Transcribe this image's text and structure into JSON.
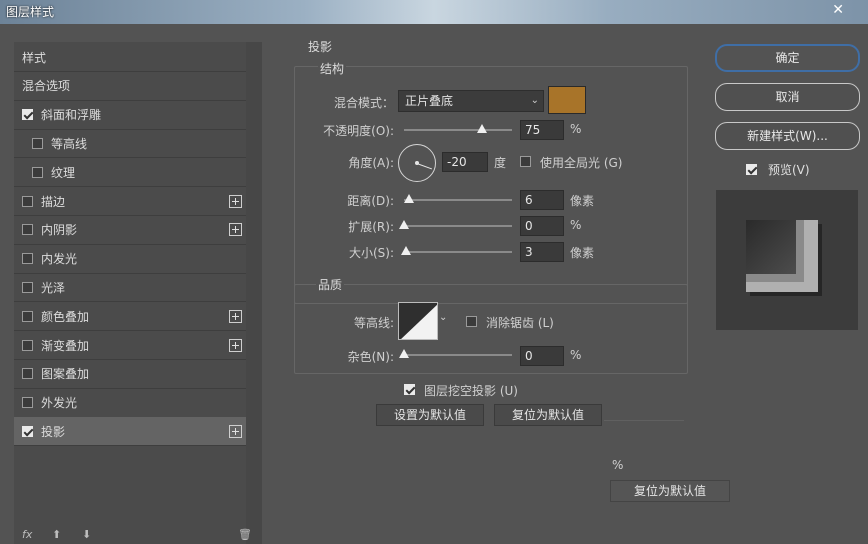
{
  "window": {
    "title": "图层样式",
    "close": "✕"
  },
  "sidebar": {
    "items": [
      {
        "label": "样式",
        "checkbox": false,
        "checked": false,
        "plus": false,
        "indent": false
      },
      {
        "label": "混合选项",
        "checkbox": false,
        "checked": false,
        "plus": false,
        "indent": false
      },
      {
        "label": "斜面和浮雕",
        "checkbox": true,
        "checked": true,
        "plus": false,
        "indent": false
      },
      {
        "label": "等高线",
        "checkbox": true,
        "checked": false,
        "plus": false,
        "indent": true
      },
      {
        "label": "纹理",
        "checkbox": true,
        "checked": false,
        "plus": false,
        "indent": true
      },
      {
        "label": "描边",
        "checkbox": true,
        "checked": false,
        "plus": true,
        "indent": false
      },
      {
        "label": "内阴影",
        "checkbox": true,
        "checked": false,
        "plus": true,
        "indent": false
      },
      {
        "label": "内发光",
        "checkbox": true,
        "checked": false,
        "plus": false,
        "indent": false
      },
      {
        "label": "光泽",
        "checkbox": true,
        "checked": false,
        "plus": false,
        "indent": false
      },
      {
        "label": "颜色叠加",
        "checkbox": true,
        "checked": false,
        "plus": true,
        "indent": false
      },
      {
        "label": "渐变叠加",
        "checkbox": true,
        "checked": false,
        "plus": true,
        "indent": false
      },
      {
        "label": "图案叠加",
        "checkbox": true,
        "checked": false,
        "plus": false,
        "indent": false
      },
      {
        "label": "外发光",
        "checkbox": true,
        "checked": false,
        "plus": false,
        "indent": false
      },
      {
        "label": "投影",
        "checkbox": true,
        "checked": true,
        "plus": true,
        "indent": false,
        "selected": true
      }
    ],
    "footer": {
      "fx": "fx",
      "up": "⬆",
      "down": "⬇",
      "trash": "🗑"
    }
  },
  "drop_shadow": {
    "section_title": "投影",
    "structure": {
      "title": "结构",
      "blend_mode_label": "混合模式：",
      "blend_mode_value": "正片叠底",
      "color": "#a87429",
      "opacity_label": "不透明度(O):",
      "opacity_value": "75",
      "opacity_unit": "%",
      "angle_label": "角度(A):",
      "angle_value": "-20",
      "angle_unit": "度",
      "global_light_label": "使用全局光 (G)",
      "global_light_checked": false,
      "distance_label": "距离(D):",
      "distance_value": "6",
      "distance_unit": "像素",
      "spread_label": "扩展(R):",
      "spread_value": "0",
      "spread_unit": "%",
      "size_label": "大小(S):",
      "size_value": "3",
      "size_unit": "像素"
    },
    "quality": {
      "title": "品质",
      "contour_label": "等高线:",
      "antialias_label": "消除锯齿 (L)",
      "antialias_checked": false,
      "noise_label": "杂色(N):",
      "noise_value": "0",
      "noise_unit": "%"
    },
    "knockout_label": "图层挖空投影 (U)",
    "knockout_checked": true,
    "set_default_label": "设置为默认值",
    "reset_default_label": "复位为默认值",
    "ghost_percent": "%",
    "ghost_reset_label": "复位为默认值"
  },
  "right": {
    "ok_label": "确定",
    "cancel_label": "取消",
    "new_style_label": "新建样式(W)...",
    "preview_label": "预览(V)",
    "preview_checked": true
  }
}
